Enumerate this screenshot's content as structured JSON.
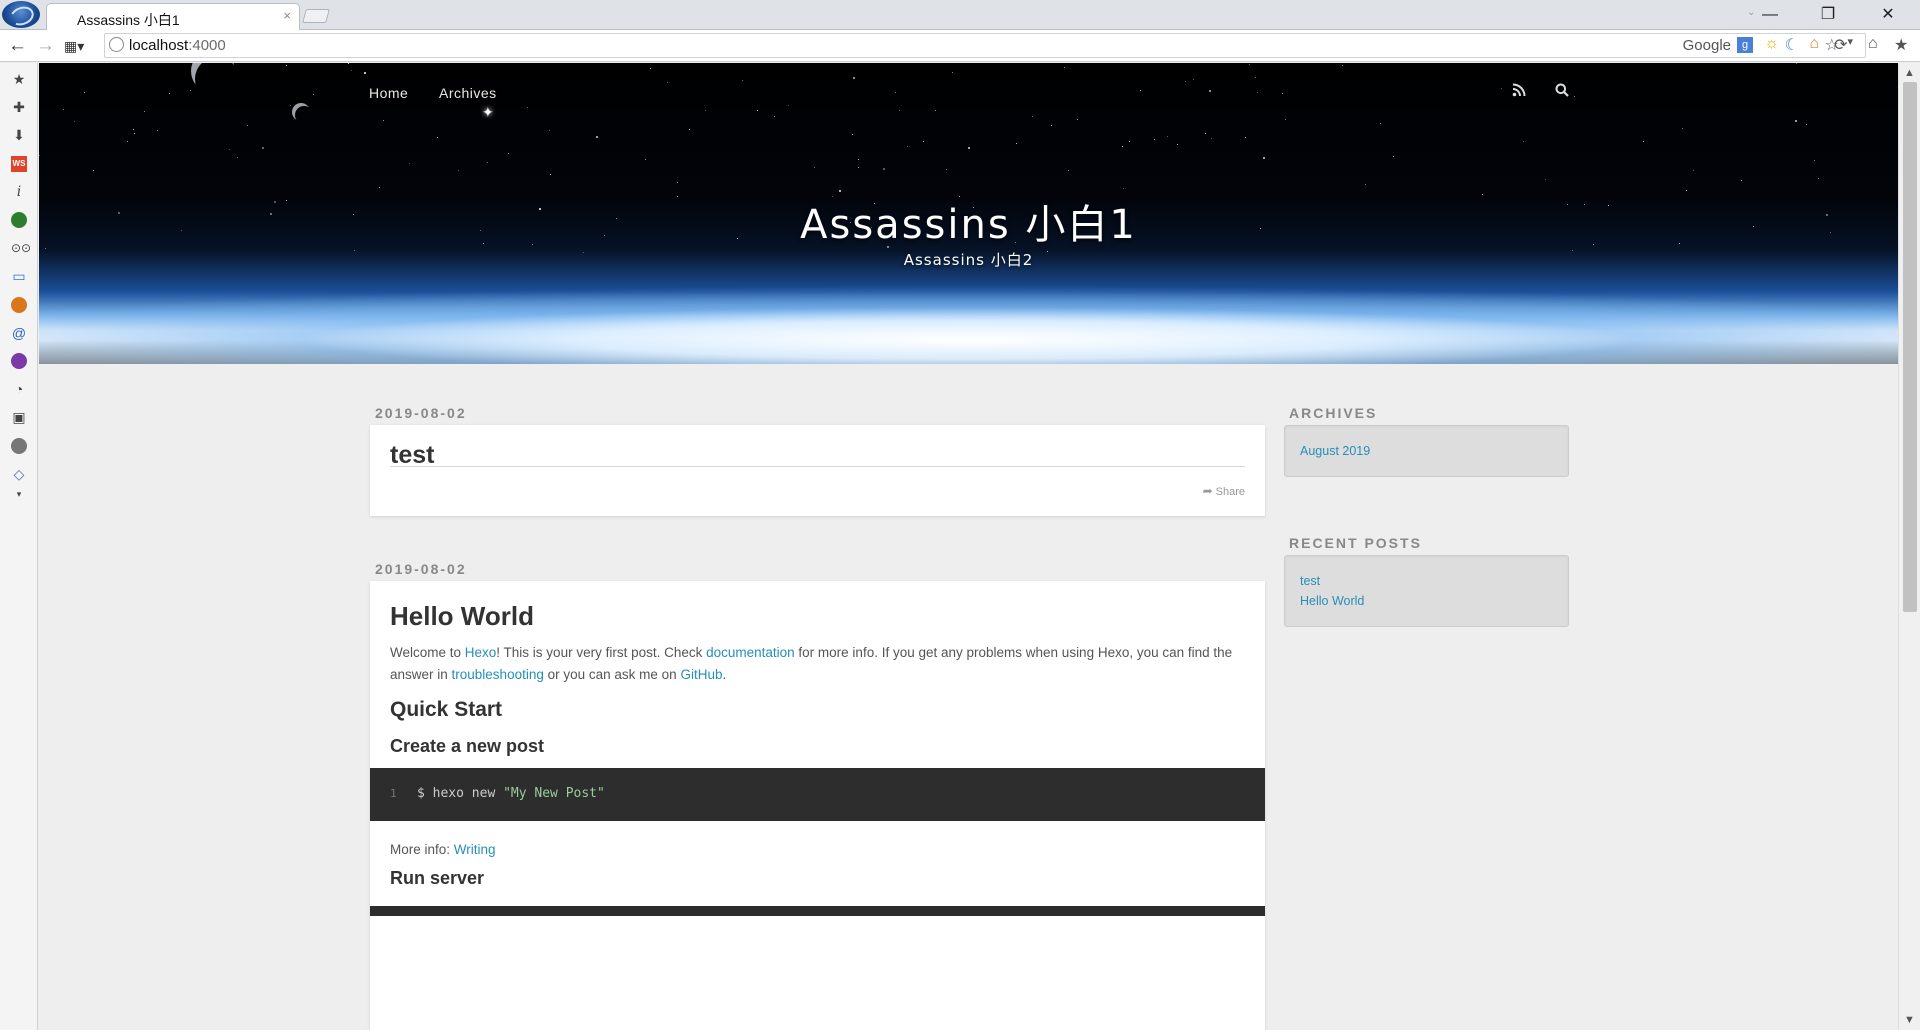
{
  "browser": {
    "tab_title": "Assassins 小白1",
    "tab_close": "×",
    "url_host": "localhost",
    "url_port": ":4000",
    "search_engine": "Google",
    "window_min": "—",
    "window_restore": "❐",
    "window_close": "✕"
  },
  "site": {
    "title": "Assassins 小白1",
    "subtitle": "Assassins 小白2",
    "nav": [
      "Home",
      "Archives"
    ]
  },
  "posts": [
    {
      "date": "2019-08-02",
      "title": "test",
      "share": "Share"
    },
    {
      "date": "2019-08-02",
      "title": "Hello World",
      "intro": {
        "t1": "Welcome to ",
        "l1": "Hexo",
        "t2": "! This is your very first post. Check ",
        "l2": "documentation",
        "t3": " for more info. If you get any problems when using Hexo, you can find the answer in ",
        "l3": "troubleshooting",
        "t4": " or you can ask me on ",
        "l4": "GitHub",
        "t5": "."
      },
      "h2_quick_start": "Quick Start",
      "h3_create": "Create a new post",
      "code_line_no": "1",
      "code_cmd": "$ hexo new ",
      "code_str": "\"My New Post\"",
      "more_info_label": "More info: ",
      "more_info_link": "Writing",
      "h3_run": "Run server"
    }
  ],
  "widgets": {
    "archives_title": "ARCHIVES",
    "archives": [
      "August 2019"
    ],
    "recent_title": "RECENT POSTS",
    "recent": [
      "test",
      "Hello World"
    ]
  },
  "colors": {
    "link": "#258fb8",
    "code_bg": "#2d2d2d",
    "page_bg": "#eeeeee"
  }
}
